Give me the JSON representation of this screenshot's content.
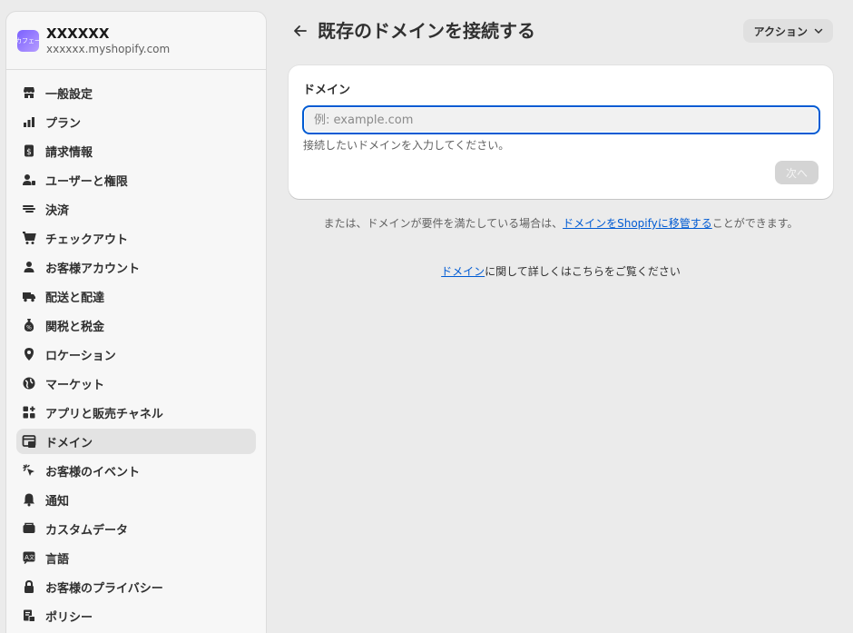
{
  "store": {
    "logo_text": "カフェー",
    "name": "XXXXXX",
    "domain": "xxxxxx.myshopify.com"
  },
  "sidebar": {
    "items": [
      {
        "label": "一般設定",
        "icon": "store-icon",
        "active": false
      },
      {
        "label": "プラン",
        "icon": "plan-icon",
        "active": false
      },
      {
        "label": "請求情報",
        "icon": "billing-icon",
        "active": false
      },
      {
        "label": "ユーザーと権限",
        "icon": "users-icon",
        "active": false
      },
      {
        "label": "決済",
        "icon": "payments-icon",
        "active": false
      },
      {
        "label": "チェックアウト",
        "icon": "cart-icon",
        "active": false
      },
      {
        "label": "お客様アカウント",
        "icon": "person-icon",
        "active": false
      },
      {
        "label": "配送と配達",
        "icon": "truck-icon",
        "active": false
      },
      {
        "label": "関税と税金",
        "icon": "tax-icon",
        "active": false
      },
      {
        "label": "ロケーション",
        "icon": "location-icon",
        "active": false
      },
      {
        "label": "マーケット",
        "icon": "globe-icon",
        "active": false
      },
      {
        "label": "アプリと販売チャネル",
        "icon": "apps-icon",
        "active": false
      },
      {
        "label": "ドメイン",
        "icon": "domain-icon",
        "active": true
      },
      {
        "label": "お客様のイベント",
        "icon": "cursor-click-icon",
        "active": false
      },
      {
        "label": "通知",
        "icon": "bell-icon",
        "active": false
      },
      {
        "label": "カスタムデータ",
        "icon": "database-icon",
        "active": false
      },
      {
        "label": "言語",
        "icon": "language-icon",
        "active": false
      },
      {
        "label": "お客様のプライバシー",
        "icon": "lock-icon",
        "active": false
      },
      {
        "label": "ポリシー",
        "icon": "policy-icon",
        "active": false
      }
    ]
  },
  "header": {
    "title": "既存のドメインを接続する",
    "action_label": "アクション"
  },
  "card": {
    "label": "ドメイン",
    "input_placeholder": "例: example.com",
    "input_value": "",
    "help_text": "接続したいドメインを入力してください。",
    "next_label": "次へ"
  },
  "note": {
    "prefix": "または、ドメインが要件を満たしている場合は、",
    "link": "ドメインをShopifyに移管する",
    "suffix": "ことができます。"
  },
  "learn_more": {
    "link": "ドメイン",
    "suffix": "に関して詳しくはこちらをご覧ください"
  },
  "colors": {
    "accent": "#005bd3",
    "background": "#ebebeb",
    "sidebar": "#f7f7f7"
  }
}
